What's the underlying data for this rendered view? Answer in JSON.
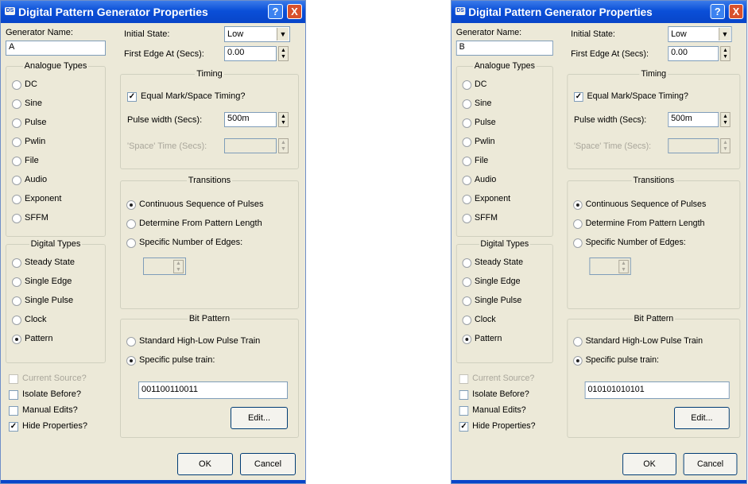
{
  "colors": {
    "titlebar": "#0845c9",
    "dialog_bg": "#ece9d8",
    "close_button": "#d9512c"
  },
  "dialogs": [
    {
      "title": "Digital Pattern Generator Properties",
      "title_icon": "DS",
      "help_label": "?",
      "close_label": "X",
      "generator_name_label": "Generator Name:",
      "generator_name_value": "A",
      "initial_state_label": "Initial State:",
      "initial_state_value": "Low",
      "first_edge_label": "First Edge At (Secs):",
      "first_edge_value": "0.00",
      "analogue_title": "Analogue Types",
      "analogue_types": [
        "DC",
        "Sine",
        "Pulse",
        "Pwlin",
        "File",
        "Audio",
        "Exponent",
        "SFFM"
      ],
      "digital_title": "Digital Types",
      "digital_types": [
        "Steady State",
        "Single Edge",
        "Single Pulse",
        "Clock",
        "Pattern"
      ],
      "digital_selected": 4,
      "checkboxes": [
        {
          "label": "Current Source?",
          "checked": false,
          "disabled": true
        },
        {
          "label": "Isolate Before?",
          "checked": false,
          "disabled": false
        },
        {
          "label": "Manual Edits?",
          "checked": false,
          "disabled": false
        },
        {
          "label": "Hide Properties?",
          "checked": true,
          "disabled": false
        }
      ],
      "timing_title": "Timing",
      "equal_mark_label": "Equal Mark/Space Timing?",
      "equal_mark_checked": true,
      "pulse_width_label": "Pulse width (Secs):",
      "pulse_width_value": "500m",
      "space_time_label": "'Space' Time (Secs):",
      "transitions_title": "Transitions",
      "transitions": [
        "Continuous Sequence of Pulses",
        "Determine From Pattern Length",
        "Specific Number of Edges:"
      ],
      "transitions_selected": 0,
      "bit_pattern_title": "Bit Pattern",
      "bit_options": [
        "Standard High-Low Pulse Train",
        "Specific pulse train:"
      ],
      "bit_selected": 1,
      "pattern_value": "001100110011",
      "edit_label": "Edit...",
      "ok_label": "OK",
      "cancel_label": "Cancel"
    },
    {
      "title": "Digital Pattern Generator Properties",
      "title_icon": "DS",
      "help_label": "?",
      "close_label": "X",
      "generator_name_label": "Generator Name:",
      "generator_name_value": "B",
      "initial_state_label": "Initial State:",
      "initial_state_value": "Low",
      "first_edge_label": "First Edge At (Secs):",
      "first_edge_value": "0.00",
      "analogue_title": "Analogue Types",
      "analogue_types": [
        "DC",
        "Sine",
        "Pulse",
        "Pwlin",
        "File",
        "Audio",
        "Exponent",
        "SFFM"
      ],
      "digital_title": "Digital Types",
      "digital_types": [
        "Steady State",
        "Single Edge",
        "Single Pulse",
        "Clock",
        "Pattern"
      ],
      "digital_selected": 4,
      "checkboxes": [
        {
          "label": "Current Source?",
          "checked": false,
          "disabled": true
        },
        {
          "label": "Isolate Before?",
          "checked": false,
          "disabled": false
        },
        {
          "label": "Manual Edits?",
          "checked": false,
          "disabled": false
        },
        {
          "label": "Hide Properties?",
          "checked": true,
          "disabled": false
        }
      ],
      "timing_title": "Timing",
      "equal_mark_label": "Equal Mark/Space Timing?",
      "equal_mark_checked": true,
      "pulse_width_label": "Pulse width (Secs):",
      "pulse_width_value": "500m",
      "space_time_label": "'Space' Time (Secs):",
      "transitions_title": "Transitions",
      "transitions": [
        "Continuous Sequence of Pulses",
        "Determine From Pattern Length",
        "Specific Number of Edges:"
      ],
      "transitions_selected": 0,
      "bit_pattern_title": "Bit Pattern",
      "bit_options": [
        "Standard High-Low Pulse Train",
        "Specific pulse train:"
      ],
      "bit_selected": 1,
      "pattern_value": "010101010101",
      "edit_label": "Edit...",
      "ok_label": "OK",
      "cancel_label": "Cancel"
    }
  ]
}
